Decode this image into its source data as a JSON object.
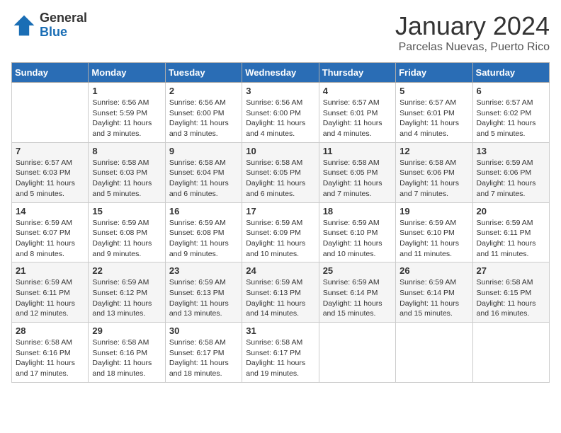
{
  "logo": {
    "general": "General",
    "blue": "Blue"
  },
  "title": "January 2024",
  "subtitle": "Parcelas Nuevas, Puerto Rico",
  "days_of_week": [
    "Sunday",
    "Monday",
    "Tuesday",
    "Wednesday",
    "Thursday",
    "Friday",
    "Saturday"
  ],
  "weeks": [
    [
      {
        "day": "",
        "sunrise": "",
        "sunset": "",
        "daylight": ""
      },
      {
        "day": "1",
        "sunrise": "Sunrise: 6:56 AM",
        "sunset": "Sunset: 5:59 PM",
        "daylight": "Daylight: 11 hours and 3 minutes."
      },
      {
        "day": "2",
        "sunrise": "Sunrise: 6:56 AM",
        "sunset": "Sunset: 6:00 PM",
        "daylight": "Daylight: 11 hours and 3 minutes."
      },
      {
        "day": "3",
        "sunrise": "Sunrise: 6:56 AM",
        "sunset": "Sunset: 6:00 PM",
        "daylight": "Daylight: 11 hours and 4 minutes."
      },
      {
        "day": "4",
        "sunrise": "Sunrise: 6:57 AM",
        "sunset": "Sunset: 6:01 PM",
        "daylight": "Daylight: 11 hours and 4 minutes."
      },
      {
        "day": "5",
        "sunrise": "Sunrise: 6:57 AM",
        "sunset": "Sunset: 6:01 PM",
        "daylight": "Daylight: 11 hours and 4 minutes."
      },
      {
        "day": "6",
        "sunrise": "Sunrise: 6:57 AM",
        "sunset": "Sunset: 6:02 PM",
        "daylight": "Daylight: 11 hours and 5 minutes."
      }
    ],
    [
      {
        "day": "7",
        "sunrise": "Sunrise: 6:57 AM",
        "sunset": "Sunset: 6:03 PM",
        "daylight": "Daylight: 11 hours and 5 minutes."
      },
      {
        "day": "8",
        "sunrise": "Sunrise: 6:58 AM",
        "sunset": "Sunset: 6:03 PM",
        "daylight": "Daylight: 11 hours and 5 minutes."
      },
      {
        "day": "9",
        "sunrise": "Sunrise: 6:58 AM",
        "sunset": "Sunset: 6:04 PM",
        "daylight": "Daylight: 11 hours and 6 minutes."
      },
      {
        "day": "10",
        "sunrise": "Sunrise: 6:58 AM",
        "sunset": "Sunset: 6:05 PM",
        "daylight": "Daylight: 11 hours and 6 minutes."
      },
      {
        "day": "11",
        "sunrise": "Sunrise: 6:58 AM",
        "sunset": "Sunset: 6:05 PM",
        "daylight": "Daylight: 11 hours and 7 minutes."
      },
      {
        "day": "12",
        "sunrise": "Sunrise: 6:58 AM",
        "sunset": "Sunset: 6:06 PM",
        "daylight": "Daylight: 11 hours and 7 minutes."
      },
      {
        "day": "13",
        "sunrise": "Sunrise: 6:59 AM",
        "sunset": "Sunset: 6:06 PM",
        "daylight": "Daylight: 11 hours and 7 minutes."
      }
    ],
    [
      {
        "day": "14",
        "sunrise": "Sunrise: 6:59 AM",
        "sunset": "Sunset: 6:07 PM",
        "daylight": "Daylight: 11 hours and 8 minutes."
      },
      {
        "day": "15",
        "sunrise": "Sunrise: 6:59 AM",
        "sunset": "Sunset: 6:08 PM",
        "daylight": "Daylight: 11 hours and 9 minutes."
      },
      {
        "day": "16",
        "sunrise": "Sunrise: 6:59 AM",
        "sunset": "Sunset: 6:08 PM",
        "daylight": "Daylight: 11 hours and 9 minutes."
      },
      {
        "day": "17",
        "sunrise": "Sunrise: 6:59 AM",
        "sunset": "Sunset: 6:09 PM",
        "daylight": "Daylight: 11 hours and 10 minutes."
      },
      {
        "day": "18",
        "sunrise": "Sunrise: 6:59 AM",
        "sunset": "Sunset: 6:10 PM",
        "daylight": "Daylight: 11 hours and 10 minutes."
      },
      {
        "day": "19",
        "sunrise": "Sunrise: 6:59 AM",
        "sunset": "Sunset: 6:10 PM",
        "daylight": "Daylight: 11 hours and 11 minutes."
      },
      {
        "day": "20",
        "sunrise": "Sunrise: 6:59 AM",
        "sunset": "Sunset: 6:11 PM",
        "daylight": "Daylight: 11 hours and 11 minutes."
      }
    ],
    [
      {
        "day": "21",
        "sunrise": "Sunrise: 6:59 AM",
        "sunset": "Sunset: 6:11 PM",
        "daylight": "Daylight: 11 hours and 12 minutes."
      },
      {
        "day": "22",
        "sunrise": "Sunrise: 6:59 AM",
        "sunset": "Sunset: 6:12 PM",
        "daylight": "Daylight: 11 hours and 13 minutes."
      },
      {
        "day": "23",
        "sunrise": "Sunrise: 6:59 AM",
        "sunset": "Sunset: 6:13 PM",
        "daylight": "Daylight: 11 hours and 13 minutes."
      },
      {
        "day": "24",
        "sunrise": "Sunrise: 6:59 AM",
        "sunset": "Sunset: 6:13 PM",
        "daylight": "Daylight: 11 hours and 14 minutes."
      },
      {
        "day": "25",
        "sunrise": "Sunrise: 6:59 AM",
        "sunset": "Sunset: 6:14 PM",
        "daylight": "Daylight: 11 hours and 15 minutes."
      },
      {
        "day": "26",
        "sunrise": "Sunrise: 6:59 AM",
        "sunset": "Sunset: 6:14 PM",
        "daylight": "Daylight: 11 hours and 15 minutes."
      },
      {
        "day": "27",
        "sunrise": "Sunrise: 6:58 AM",
        "sunset": "Sunset: 6:15 PM",
        "daylight": "Daylight: 11 hours and 16 minutes."
      }
    ],
    [
      {
        "day": "28",
        "sunrise": "Sunrise: 6:58 AM",
        "sunset": "Sunset: 6:16 PM",
        "daylight": "Daylight: 11 hours and 17 minutes."
      },
      {
        "day": "29",
        "sunrise": "Sunrise: 6:58 AM",
        "sunset": "Sunset: 6:16 PM",
        "daylight": "Daylight: 11 hours and 18 minutes."
      },
      {
        "day": "30",
        "sunrise": "Sunrise: 6:58 AM",
        "sunset": "Sunset: 6:17 PM",
        "daylight": "Daylight: 11 hours and 18 minutes."
      },
      {
        "day": "31",
        "sunrise": "Sunrise: 6:58 AM",
        "sunset": "Sunset: 6:17 PM",
        "daylight": "Daylight: 11 hours and 19 minutes."
      },
      {
        "day": "",
        "sunrise": "",
        "sunset": "",
        "daylight": ""
      },
      {
        "day": "",
        "sunrise": "",
        "sunset": "",
        "daylight": ""
      },
      {
        "day": "",
        "sunrise": "",
        "sunset": "",
        "daylight": ""
      }
    ]
  ]
}
